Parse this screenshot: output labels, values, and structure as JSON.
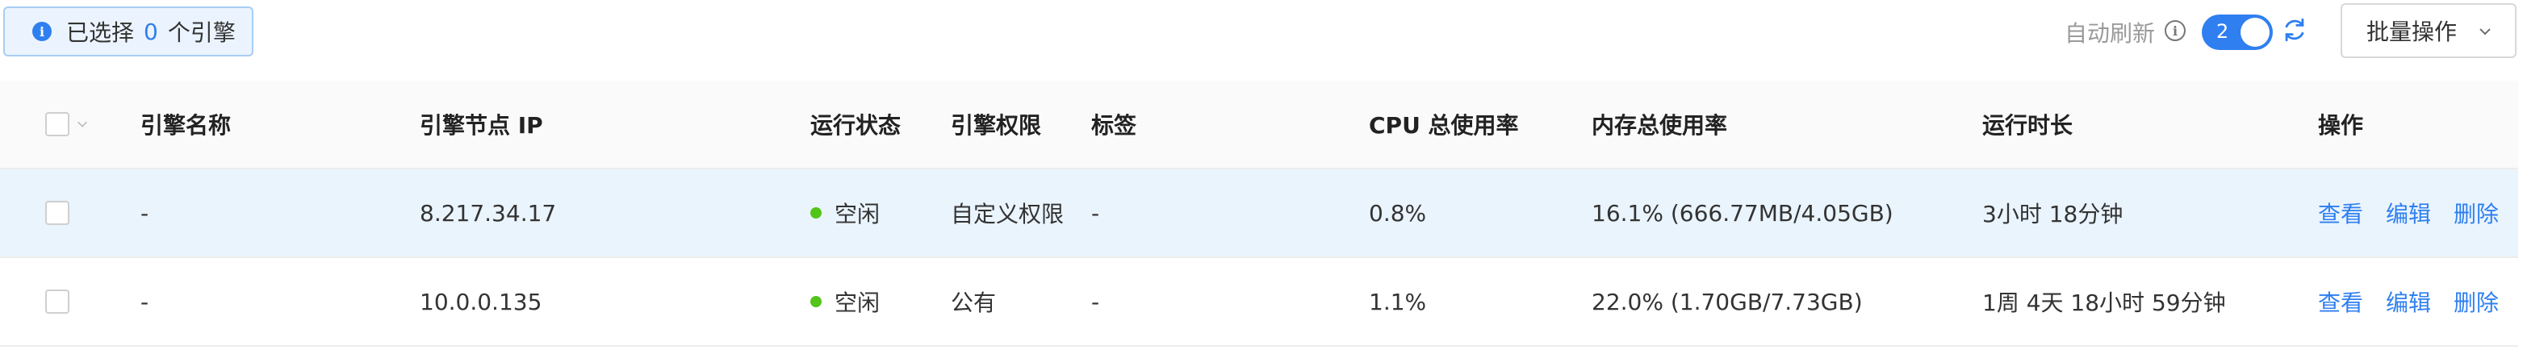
{
  "selection": {
    "prefix": "已选择",
    "count": "0",
    "suffix": "个引擎"
  },
  "toolbar": {
    "auto_refresh_label": "自动刷新",
    "refresh_interval": "2",
    "batch_label": "批量操作"
  },
  "table": {
    "headers": {
      "name": "引擎名称",
      "ip": "引擎节点 IP",
      "status": "运行状态",
      "permission": "引擎权限",
      "tags": "标签",
      "cpu": "CPU 总使用率",
      "memory": "内存总使用率",
      "uptime": "运行时长",
      "actions": "操作"
    },
    "rows": [
      {
        "name": "-",
        "ip": "8.217.34.17",
        "status": "空闲",
        "permission": "自定义权限",
        "tags": "-",
        "cpu": "0.8%",
        "memory": "16.1% (666.77MB/4.05GB)",
        "uptime": "3小时 18分钟",
        "view": "查看",
        "edit": "编辑",
        "delete": "删除"
      },
      {
        "name": "-",
        "ip": "10.0.0.135",
        "status": "空闲",
        "permission": "公有",
        "tags": "-",
        "cpu": "1.1%",
        "memory": "22.0% (1.70GB/7.73GB)",
        "uptime": "1周 4天 18小时 59分钟",
        "view": "查看",
        "edit": "编辑",
        "delete": "删除"
      }
    ]
  },
  "colors": {
    "accent": "#2f7ff0",
    "status_idle": "#52c41a",
    "row_highlight": "#eaf4fd"
  }
}
